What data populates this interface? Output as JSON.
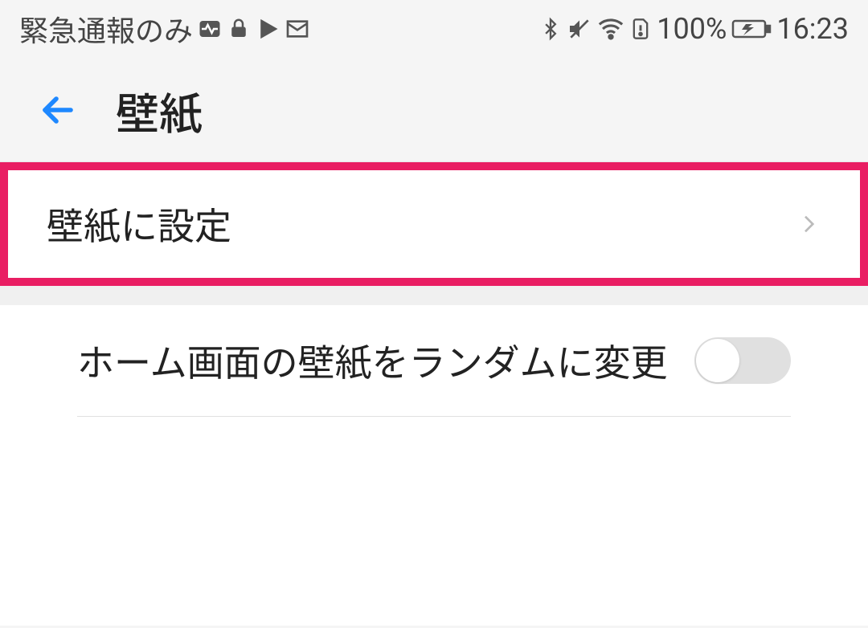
{
  "status_bar": {
    "carrier": "緊急通報のみ",
    "battery": "100%",
    "time": "16:23"
  },
  "header": {
    "title": "壁紙"
  },
  "rows": {
    "set_wallpaper": {
      "label": "壁紙に設定"
    },
    "random_wallpaper": {
      "label": "ホーム画面の壁紙をランダムに変更",
      "toggled": false
    }
  }
}
